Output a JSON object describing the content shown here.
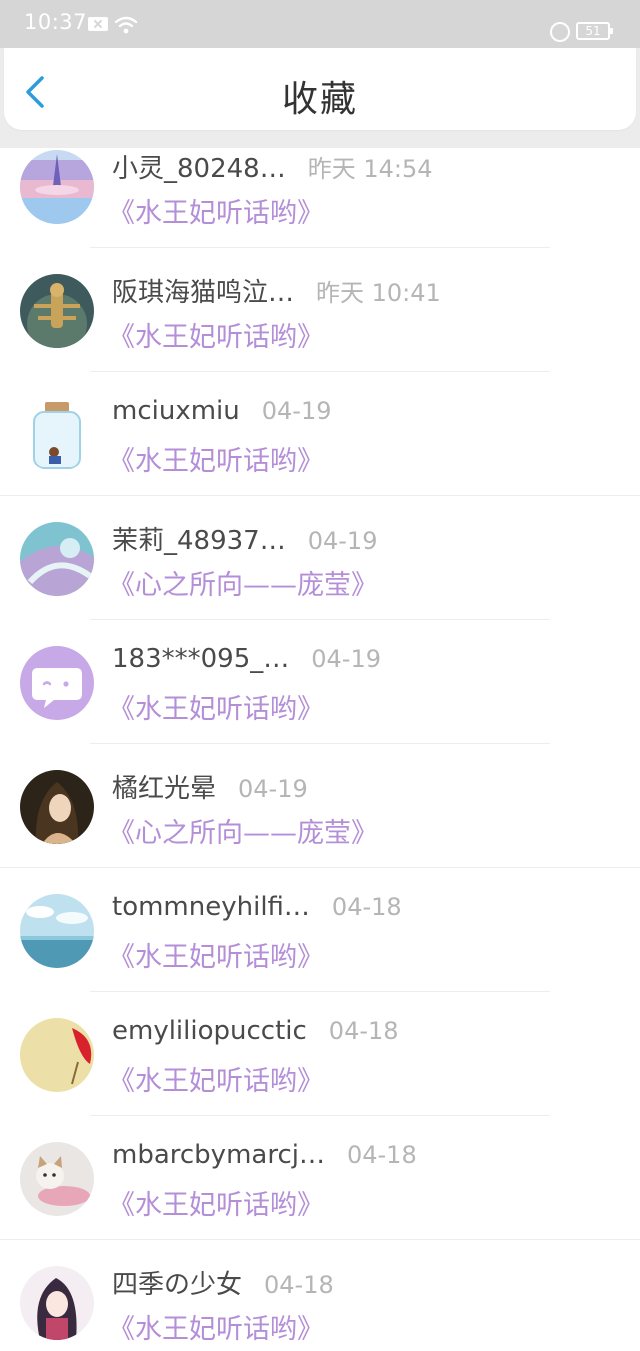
{
  "status_bar": {
    "time": "10:37",
    "battery": "51"
  },
  "header": {
    "title": "收藏",
    "back_icon": "chevron-left-icon",
    "accent": "#2d9cdb"
  },
  "colors": {
    "title_text": "#b48fd8",
    "name_text": "#4a4a4a",
    "time_text": "#b5b5b5"
  },
  "favorites": [
    {
      "name": "小灵_80248…",
      "time": "昨天 14:54",
      "title": "《水王妃听话哟》"
    },
    {
      "name": "阪琪海猫鸣泣…",
      "time": "昨天 10:41",
      "title": "《水王妃听话哟》"
    },
    {
      "name": "mciuxmiu",
      "time": "04-19",
      "title": "《水王妃听话哟》"
    },
    {
      "name": "茉莉_48937…",
      "time": "04-19",
      "title": "《心之所向——庞莹》"
    },
    {
      "name": "183***095_…",
      "time": "04-19",
      "title": "《水王妃听话哟》"
    },
    {
      "name": "橘红光晕",
      "time": "04-19",
      "title": "《心之所向——庞莹》"
    },
    {
      "name": "tommneyhilfi…",
      "time": "04-18",
      "title": "《水王妃听话哟》"
    },
    {
      "name": "emyliliopucctic",
      "time": "04-18",
      "title": "《水王妃听话哟》"
    },
    {
      "name": "mbarcbymarcj…",
      "time": "04-18",
      "title": "《水王妃听话哟》"
    },
    {
      "name": "四季の少女",
      "time": "04-18",
      "title": "《水王妃听话哟》"
    }
  ]
}
